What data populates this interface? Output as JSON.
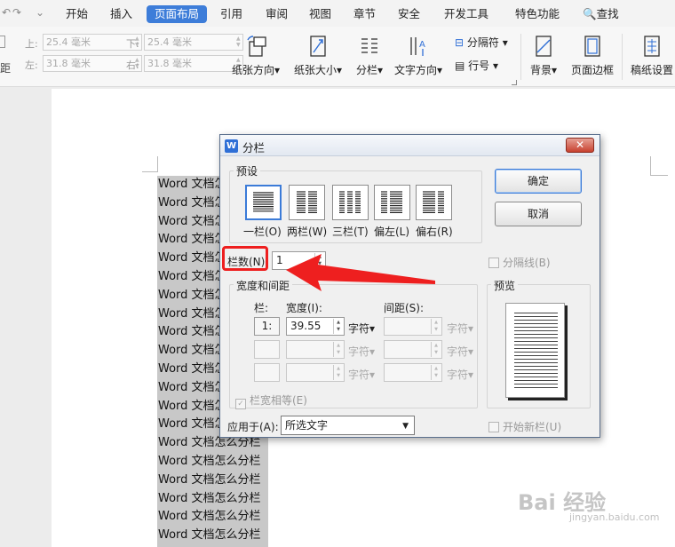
{
  "menubar": {
    "items": [
      "开始",
      "插入",
      "页面布局",
      "引用",
      "审阅",
      "视图",
      "章节",
      "安全",
      "开发工具",
      "特色功能"
    ],
    "search": "查找"
  },
  "ribbon": {
    "margins": {
      "top_label": "上:",
      "top_value": "25.4 毫米",
      "bottom_label": "下:",
      "bottom_value": "25.4 毫米",
      "left_label": "左:",
      "left_value": "31.8 毫米",
      "right_label": "右:",
      "right_value": "31.8 毫米"
    },
    "cut_label": "距",
    "orientation": "纸张方向",
    "size": "纸张大小",
    "columns": "分栏",
    "text_direction": "文字方向",
    "separator": "分隔符",
    "line_numbers": "行号",
    "background": "背景",
    "page_border": "页面边框",
    "draft_paper": "稿纸设置"
  },
  "document": {
    "lines": [
      "Word 文档怎么分栏",
      "Word 文档怎么分栏",
      "Word 文档怎么分栏",
      "Word 文档怎么分栏",
      "Word 文档怎么分栏",
      "Word 文档怎么分栏",
      "Word 文档怎么分栏",
      "Word 文档怎么分栏",
      "Word 文档怎么分栏",
      "Word 文档怎么分栏",
      "Word 文档怎么分栏",
      "Word 文档怎么分栏",
      "Word 文档怎么分栏",
      "Word 文档怎么分栏",
      "Word 文档怎么分栏",
      "Word 文档怎么分栏",
      "Word 文档怎么分栏",
      "Word 文档怎么分栏",
      "Word 文档怎么分栏",
      "Word 文档怎么分栏"
    ]
  },
  "dialog": {
    "title": "分栏",
    "presets_label": "预设",
    "presets": [
      "一栏(O)",
      "两栏(W)",
      "三栏(T)",
      "偏左(L)",
      "偏右(R)"
    ],
    "ok": "确定",
    "cancel": "取消",
    "num_columns_label": "栏数(N)",
    "num_columns_value": "1",
    "separator_line": "分隔线(B)",
    "width_spacing_label": "宽度和间距",
    "col_header": "栏:",
    "width_header": "宽度(I):",
    "spacing_header": "间距(S):",
    "rows": [
      {
        "no": "1:",
        "width": "39.55",
        "unit": "字符",
        "spacing": "",
        "spacing_unit": "字符"
      },
      {
        "no": "",
        "width": "",
        "unit": "字符",
        "spacing": "",
        "spacing_unit": "字符"
      },
      {
        "no": "",
        "width": "",
        "unit": "字符",
        "spacing": "",
        "spacing_unit": "字符"
      }
    ],
    "equal_width": "栏宽相等(E)",
    "preview_label": "预览",
    "apply_label": "应用于(A):",
    "apply_value": "所选文字",
    "new_column": "开始新栏(U)"
  },
  "annotation": {
    "color": "#ee1f1f"
  },
  "watermark": {
    "text": "Bai 经验",
    "sub": "jingyan.baidu.com"
  },
  "colors": {
    "accent": "#3d7dd9",
    "selection": "#c8c8c8"
  }
}
